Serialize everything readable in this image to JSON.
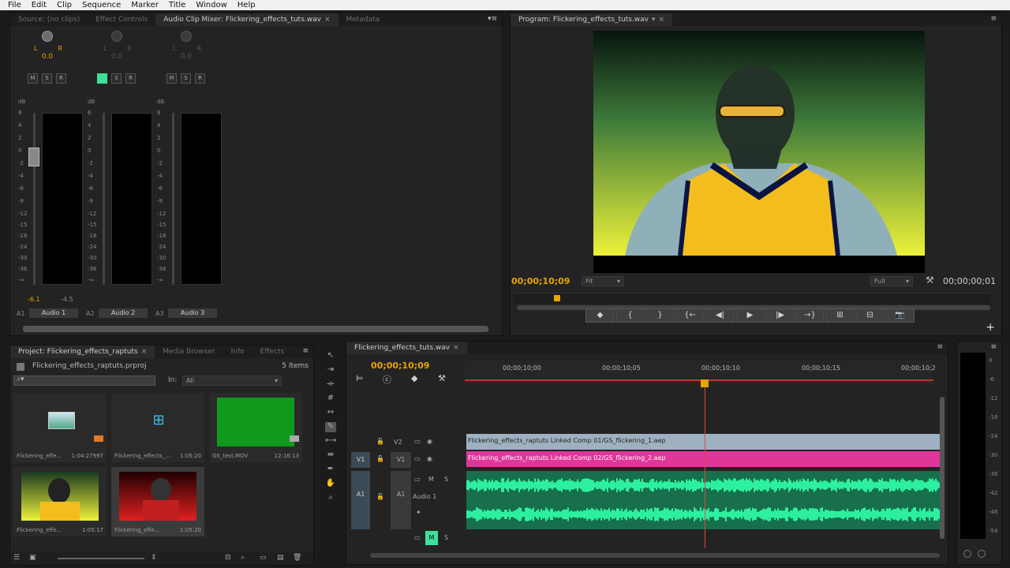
{
  "menubar": [
    "File",
    "Edit",
    "Clip",
    "Sequence",
    "Marker",
    "Title",
    "Window",
    "Help"
  ],
  "source_panel": {
    "tabs": [
      "Source: (no clips)",
      "Effect Controls",
      "Audio Clip Mixer: Flickering_effects_tuts.wav",
      "Metadata"
    ],
    "channels": [
      {
        "id": "A1",
        "name": "Audio 1",
        "pan": "0.0",
        "vol_left": "-6.1",
        "vol_right": "-4.5"
      },
      {
        "id": "A2",
        "name": "Audio 2",
        "pan": "0.0"
      },
      {
        "id": "A3",
        "name": "Audio 3",
        "pan": "0.0"
      }
    ],
    "pan_l": "L",
    "pan_r": "R",
    "db": "dB",
    "meter_scale": [
      "6",
      "4",
      "2",
      "0",
      "-2",
      "-4",
      "-6",
      "-9",
      "-12",
      "-15",
      "-18",
      "-24",
      "-30",
      "-36",
      "-∞"
    ],
    "msr": [
      "M",
      "S",
      "R"
    ]
  },
  "program": {
    "tab": "Program: Flickering_effects_tuts.wav",
    "timecode": "00;00;10;09",
    "fit": "Fit",
    "quality": "Full",
    "duration": "00;00;00;01",
    "transport": [
      "◆",
      "{",
      "}",
      "{←",
      "◀|",
      "▶",
      "|▶",
      "→}",
      "⊞",
      "⊟",
      "📷"
    ]
  },
  "project": {
    "tabs": [
      "Project: Flickering_effects_raptuts",
      "Media Browser",
      "Info",
      "Effects"
    ],
    "file": "Flickering_effects_raptuts.prproj",
    "item_count": "5 Items",
    "in_label": "In:",
    "in_value": "All",
    "items": [
      {
        "name": "Flickering_effe...",
        "duration": "1:04:27997"
      },
      {
        "name": "Flickering_effects_...",
        "duration": "1:05:20"
      },
      {
        "name": "GS_test.MOV",
        "duration": "12:16:13"
      },
      {
        "name": "Flickering_effe...",
        "duration": "1:05:17"
      },
      {
        "name": "Flickering_effe...",
        "duration": "1:05:20"
      }
    ]
  },
  "timeline": {
    "tab": "Flickering_effects_tuts.wav",
    "timecode": "00;00;10;09",
    "ticks": [
      "00;00;10;00",
      "00;00;10;05",
      "00;00;10;10",
      "00;00;10;15",
      "00;00;10;2"
    ],
    "tracks": {
      "v2": "V2",
      "v1_src": "V1",
      "v1": "V1",
      "a1_src": "A1",
      "a1": "A1",
      "a1_name": "Audio 1"
    },
    "clips": {
      "v2": "Flickering_effects_raptuts Linked Comp 01/GS_flickering_1.aep",
      "v1": "Flickering_effects_raptuts Linked Comp 02/GS_flickering_2.aep"
    },
    "colors": {
      "v2": "#9fb1c1",
      "v1": "#e0369a",
      "audio": "#1fbf7f"
    }
  },
  "master_meter": {
    "scale": [
      "0",
      "-6",
      "-12",
      "-18",
      "-24",
      "-30",
      "-36",
      "-42",
      "-48",
      "-54"
    ]
  }
}
